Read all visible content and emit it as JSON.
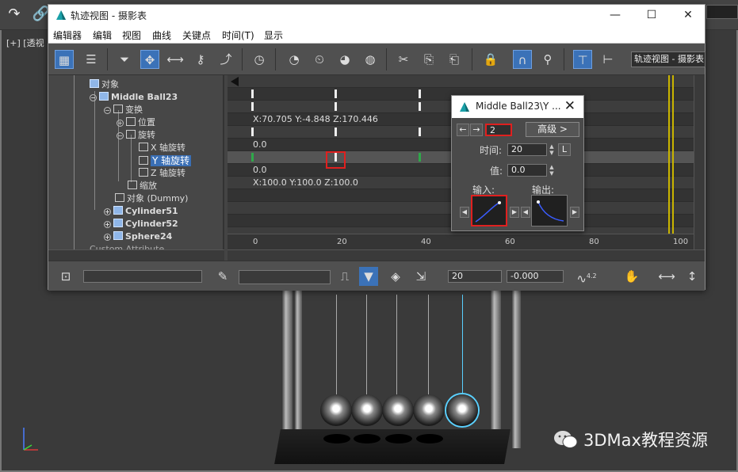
{
  "viewport": {
    "label": "[+] [透视",
    "watermark": "3DMax教程资源"
  },
  "window": {
    "title": "轨迹视图 - 摄影表",
    "minimize_icon": "—",
    "maximize_icon": "☐",
    "close_icon": "✕"
  },
  "menus": [
    "编辑器",
    "编辑",
    "视图",
    "曲线",
    "关键点",
    "时间(T)",
    "显示"
  ],
  "toolbar": {
    "view_name": "轨迹视图 - 摄影表"
  },
  "tree": {
    "items": [
      {
        "label": "对象"
      },
      {
        "label": "Middle Ball23"
      },
      {
        "label": "变换"
      },
      {
        "label": "位置"
      },
      {
        "label": "旋转"
      },
      {
        "label": "X 轴旋转"
      },
      {
        "label": "Y 轴旋转"
      },
      {
        "label": "Z 轴旋转"
      },
      {
        "label": "缩放"
      },
      {
        "label": "对象 (Dummy)"
      },
      {
        "label": "Cylinder51"
      },
      {
        "label": "Cylinder52"
      },
      {
        "label": "Sphere24"
      },
      {
        "label": "Custom Attribute"
      }
    ]
  },
  "graph": {
    "rotation_readout": "X:70.705 Y:-4.848 Z:170.446",
    "x_value": "0.0",
    "z_value": "0.0",
    "scale_readout": "X:100.0 Y:100.0 Z:100.0",
    "ruler_ticks": [
      "0",
      "20",
      "40",
      "60",
      "80",
      "100"
    ]
  },
  "key_dialog": {
    "title": "Middle Ball23\\Y ...",
    "close_icon": "✕",
    "key_number": "2",
    "advanced_label": "高级 >",
    "time_label": "时间:",
    "time_value": "20",
    "lock_label": "L",
    "value_label": "值:",
    "value_value": "0.0",
    "in_label": "输入:",
    "out_label": "输出:"
  },
  "status": {
    "frame_value": "20",
    "value_field": "-0.000",
    "curve_label": "4.2"
  },
  "colors": {
    "selection_blue": "#3a6fb5",
    "highlight_red": "#e0201f",
    "time_slider": "#c9b400"
  }
}
